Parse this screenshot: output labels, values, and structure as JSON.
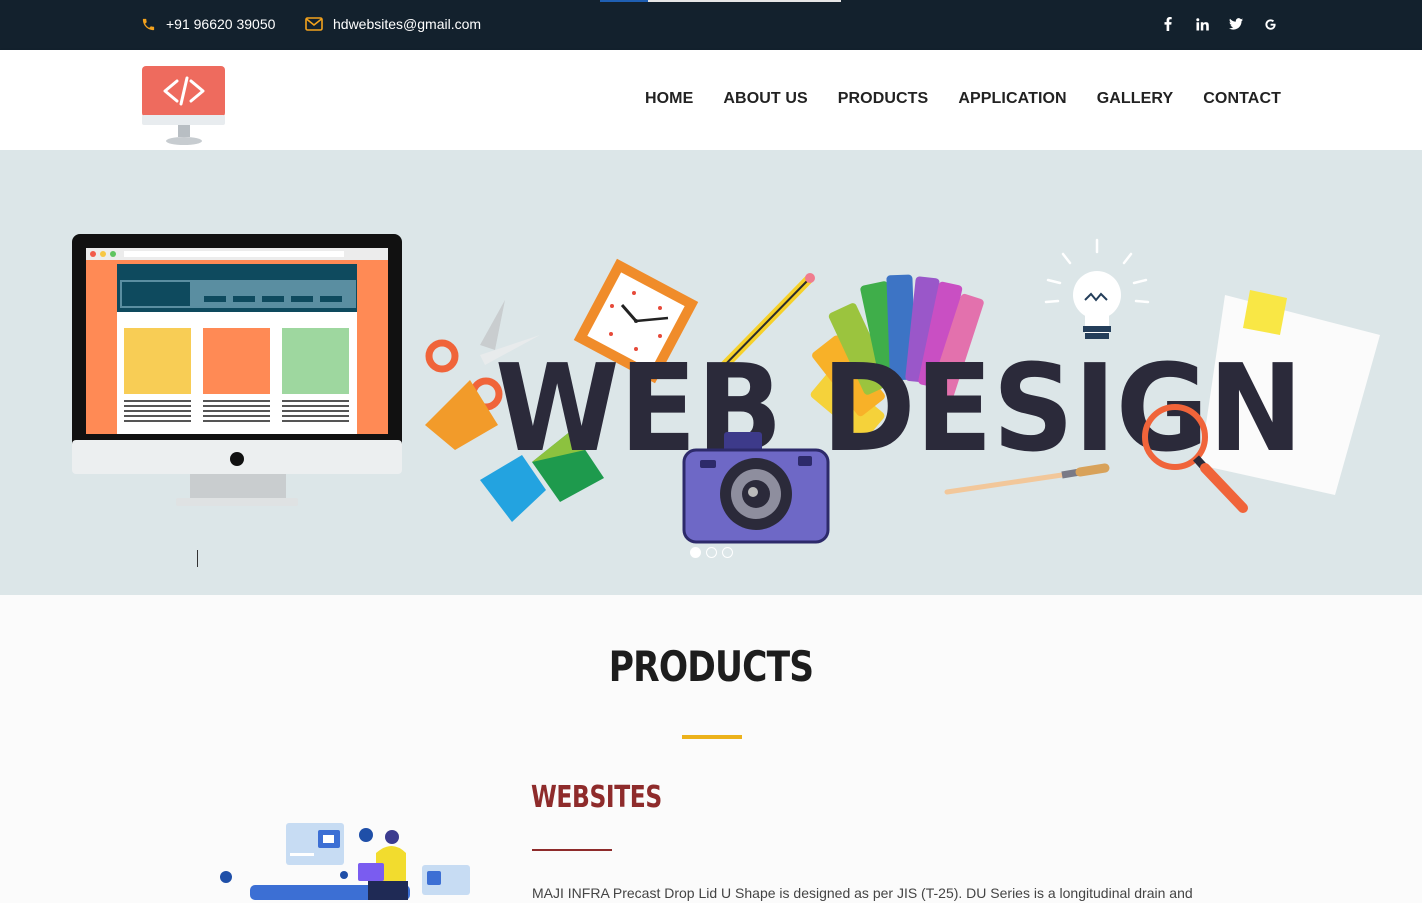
{
  "topbar": {
    "phone": "+91 96620 39050",
    "email": "hdwebsites@gmail.com",
    "social": [
      {
        "icon": "facebook-icon",
        "glyph": "f"
      },
      {
        "icon": "linkedin-icon",
        "glyph": "in"
      },
      {
        "icon": "twitter-icon",
        "glyph": "t"
      },
      {
        "icon": "google-icon",
        "glyph": "G"
      }
    ]
  },
  "nav": {
    "items": [
      "HOME",
      "ABOUT US",
      "PRODUCTS",
      "APPLICATION",
      "GALLERY",
      "CONTACT"
    ]
  },
  "hero": {
    "headline": "WEB DESIGN",
    "slides": 3,
    "active_slide": 1
  },
  "products": {
    "title": "PRODUCTS",
    "item_title": "WEBSITES",
    "item_desc": "MAJI INFRA Precast Drop Lid U Shape is designed as per JIS (T-25). DU Series is a longitudinal drain and"
  },
  "colors": {
    "topbar_bg": "#13212d",
    "accent_yellow": "#ecb21b",
    "maroon": "#8e2b2b",
    "hero_bg": "#dce6e8",
    "logo_red": "#ee6b5e"
  }
}
